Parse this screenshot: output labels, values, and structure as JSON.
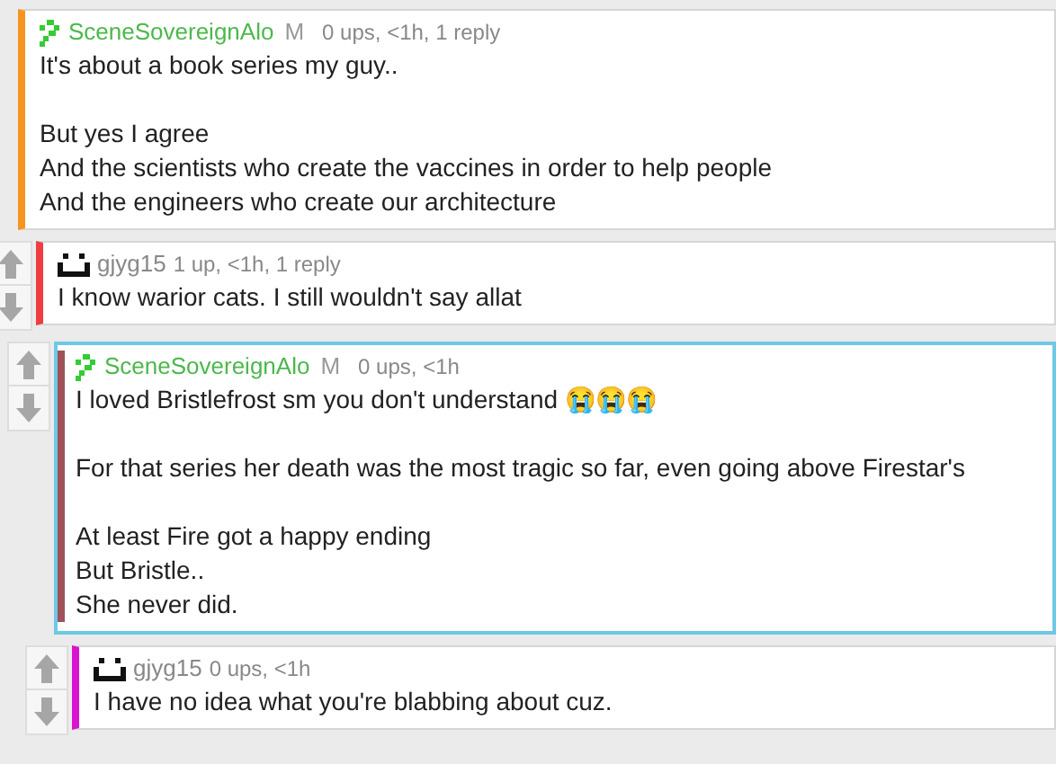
{
  "comments": [
    {
      "author": "SceneSovereignAlo",
      "avatar": {
        "kind": "blocks"
      },
      "badge": "M",
      "meta": "0 ups, <1h, 1 reply",
      "body": "It's about a book series my guy..\n\nBut yes I agree\nAnd the scientists who create the vaccines in order to help people\nAnd the engineers who create our architecture",
      "color": "#f7941d",
      "highlighted": false,
      "vote_arrows": false,
      "children": [
        {
          "author": "gjyg15",
          "avatar": {
            "kind": "face"
          },
          "meta": "1 up, <1h, 1 reply",
          "body": "I know warior cats. I still wouldn't say allat",
          "color": "#ef3e42",
          "highlighted": false,
          "vote_arrows": true,
          "children": [
            {
              "author": "SceneSovereignAlo",
              "avatar": {
                "kind": "blocks"
              },
              "badge": "M",
              "meta": "0 ups, <1h",
              "body": "I loved Bristlefrost sm you don't understand 😭😭😭\n\nFor that series her death was the most tragic so far, even going above Firestar's\n\nAt least Fire got a happy ending\nBut Bristle..\nShe never did.",
              "color": "#a0525a",
              "highlighted": true,
              "vote_arrows": true,
              "children": [
                {
                  "author": "gjyg15",
                  "avatar": {
                    "kind": "face"
                  },
                  "meta": "0 ups, <1h",
                  "body": "I have no idea what you're blabbing about cuz.",
                  "color": "#d914d0",
                  "highlighted": false,
                  "vote_arrows": true
                }
              ]
            }
          ]
        }
      ]
    }
  ]
}
